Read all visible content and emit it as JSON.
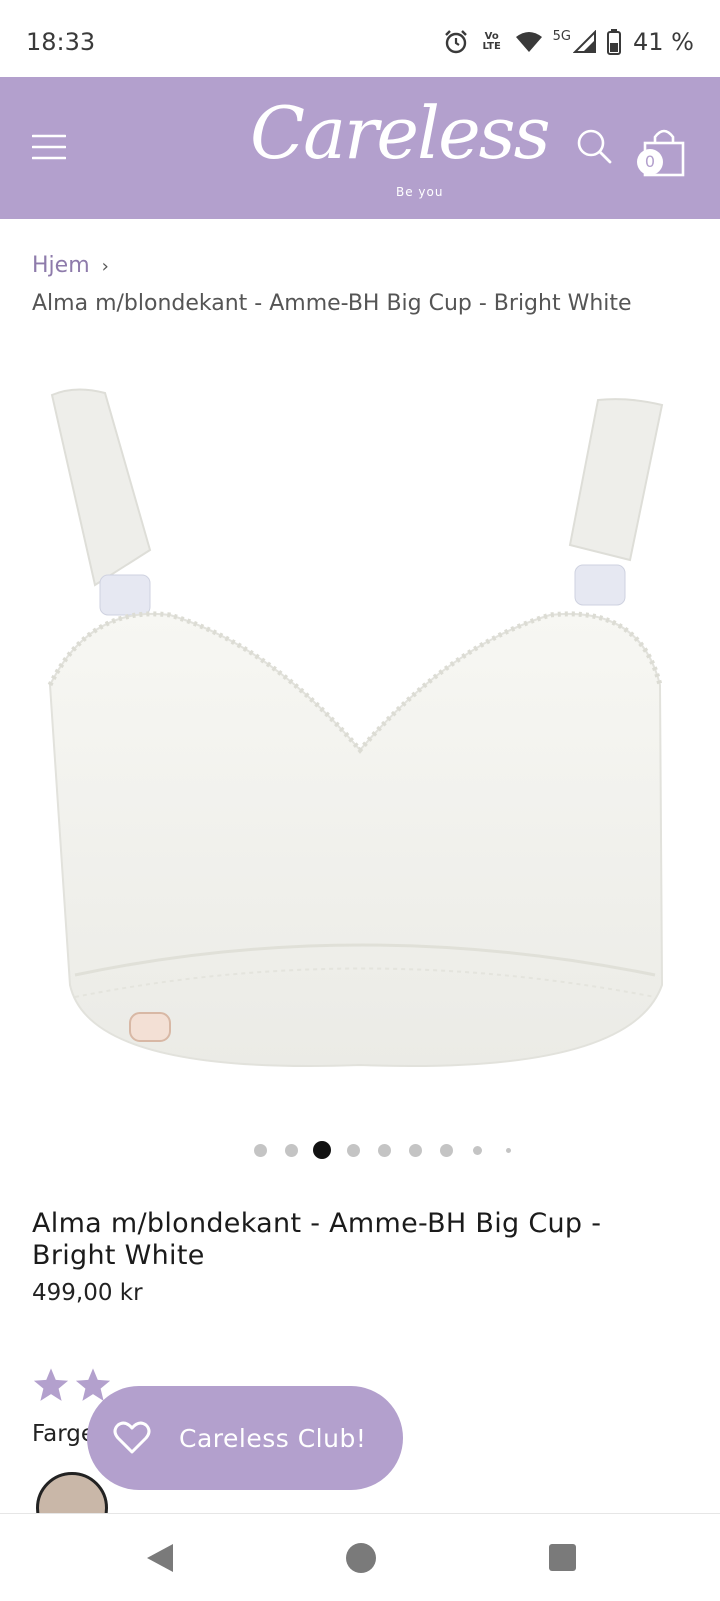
{
  "status_bar": {
    "time": "18:33",
    "battery": "41 %",
    "network_label": "5G",
    "volte_label": "Vo LTE",
    "icons": [
      "alarm-icon",
      "volte-icon",
      "wifi-icon",
      "signal-icon",
      "battery-icon"
    ]
  },
  "header": {
    "logo_text": "Careless",
    "logo_tagline": "Be you",
    "cart_count": "0",
    "background": "#b3a0cd",
    "icons": [
      "menu-icon",
      "search-icon",
      "cart-icon"
    ]
  },
  "breadcrumb": {
    "home": "Hjem",
    "separator": "›",
    "current": "Alma m/blondekant - Amme-BH Big Cup - Bright White"
  },
  "gallery": {
    "dot_count": 9,
    "active_dot": 3
  },
  "product": {
    "title": "Alma m/blondekant - Amme-BH Big Cup - Bright White",
    "price": "499,00 kr",
    "color_label": "Farge:"
  },
  "club_button": {
    "label": "Careless Club!",
    "icon": "heart-icon"
  },
  "nav_bar": {
    "icons": [
      "back-icon",
      "home-icon",
      "recents-icon"
    ]
  }
}
